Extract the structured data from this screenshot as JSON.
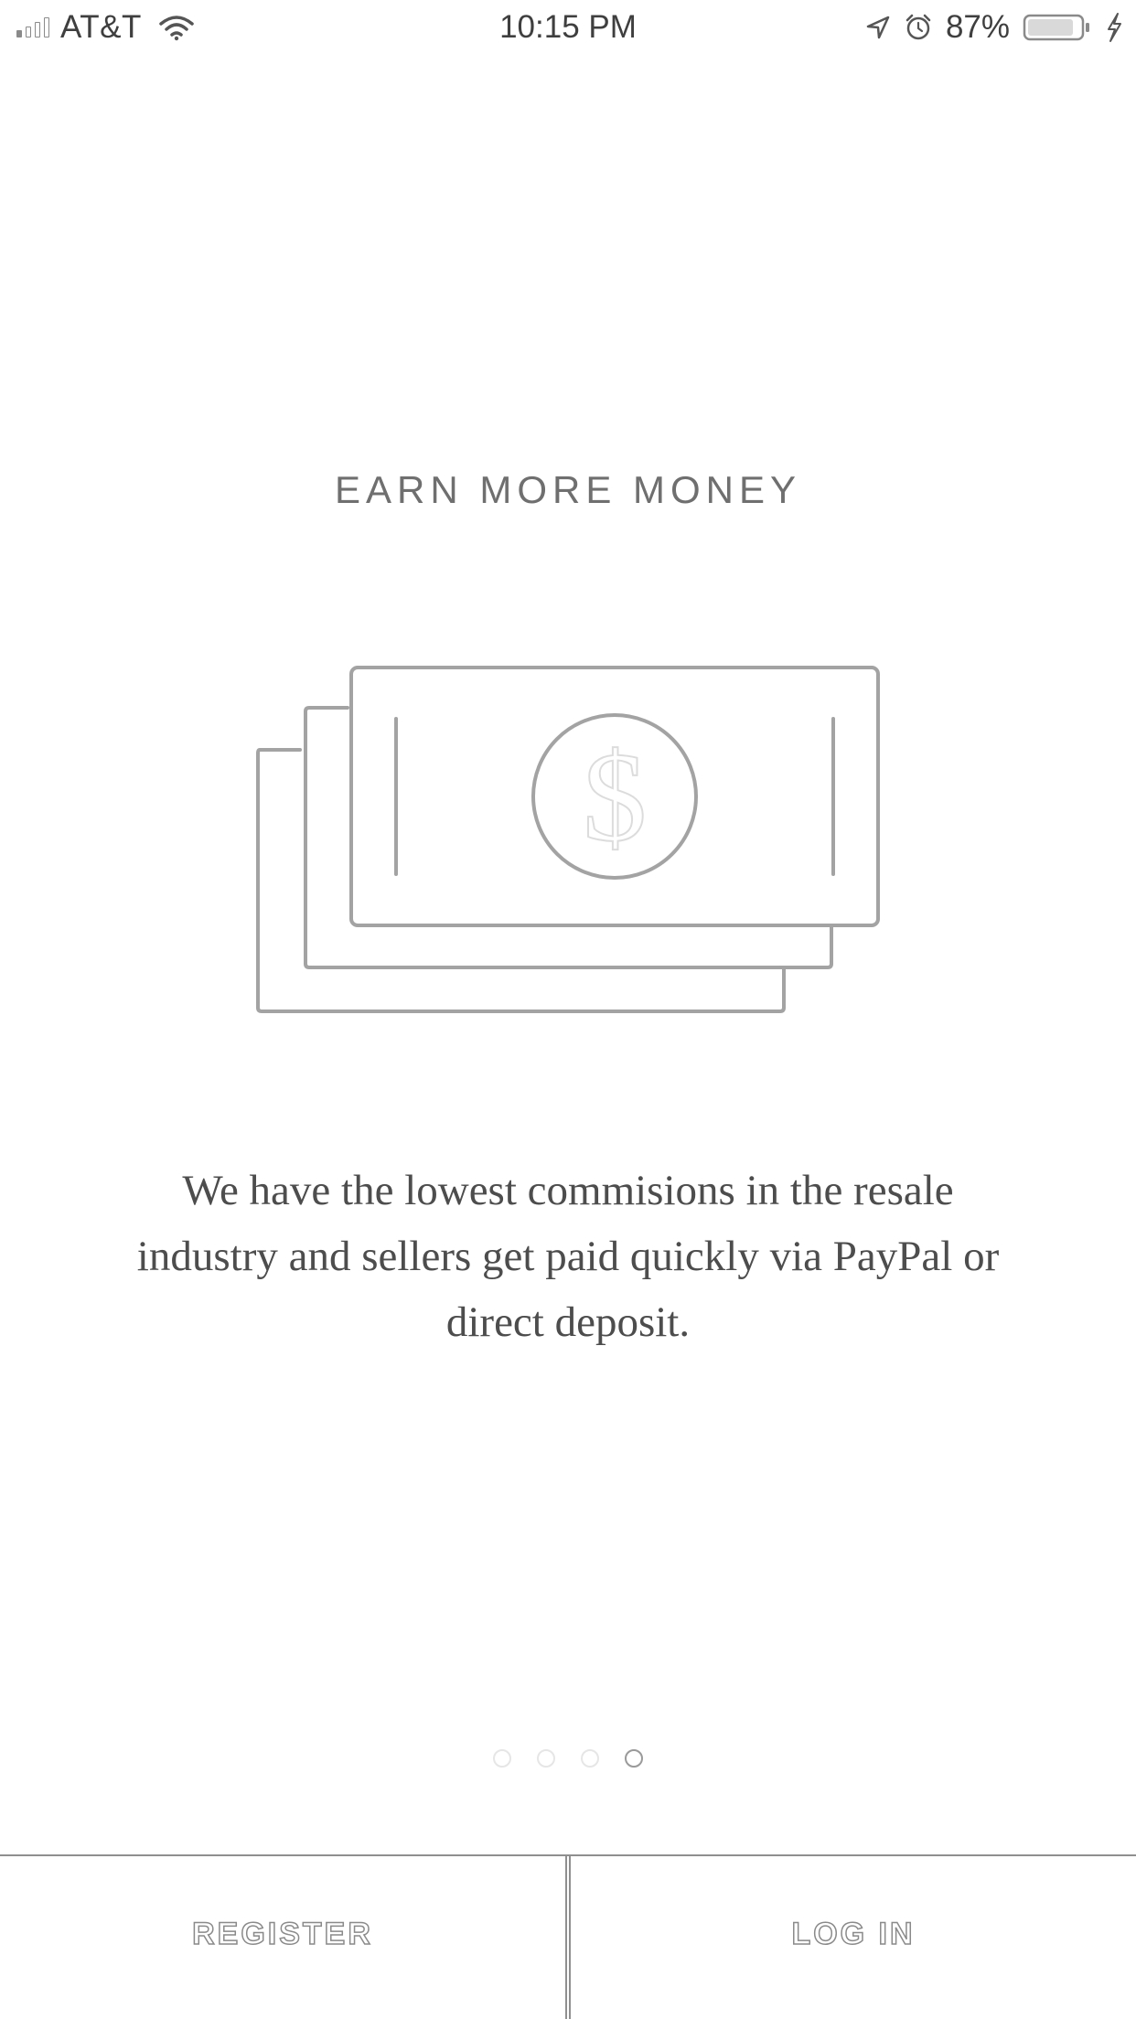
{
  "status_bar": {
    "carrier": "AT&T",
    "time": "10:15 PM",
    "battery_percent": "87%",
    "signal_bars_filled": 1,
    "signal_bars_total": 4,
    "battery_level": 0.87,
    "icons": [
      "signal-icon",
      "wifi-icon",
      "location-arrow-icon",
      "alarm-clock-icon",
      "battery-icon",
      "charging-bolt-icon"
    ]
  },
  "slide": {
    "title": "EARN MORE MONEY",
    "illustration_icon": "money-stack-icon",
    "body": "We have the lowest commisions in the resale industry and sellers get paid quickly via PayPal or direct deposit."
  },
  "pagination": {
    "total": 4,
    "current_index": 3
  },
  "actions": {
    "register_label": "REGISTER",
    "login_label": "LOG IN"
  },
  "colors": {
    "background": "#ffffff",
    "line": "#9a9a9a",
    "text": "#4d4d4d"
  }
}
